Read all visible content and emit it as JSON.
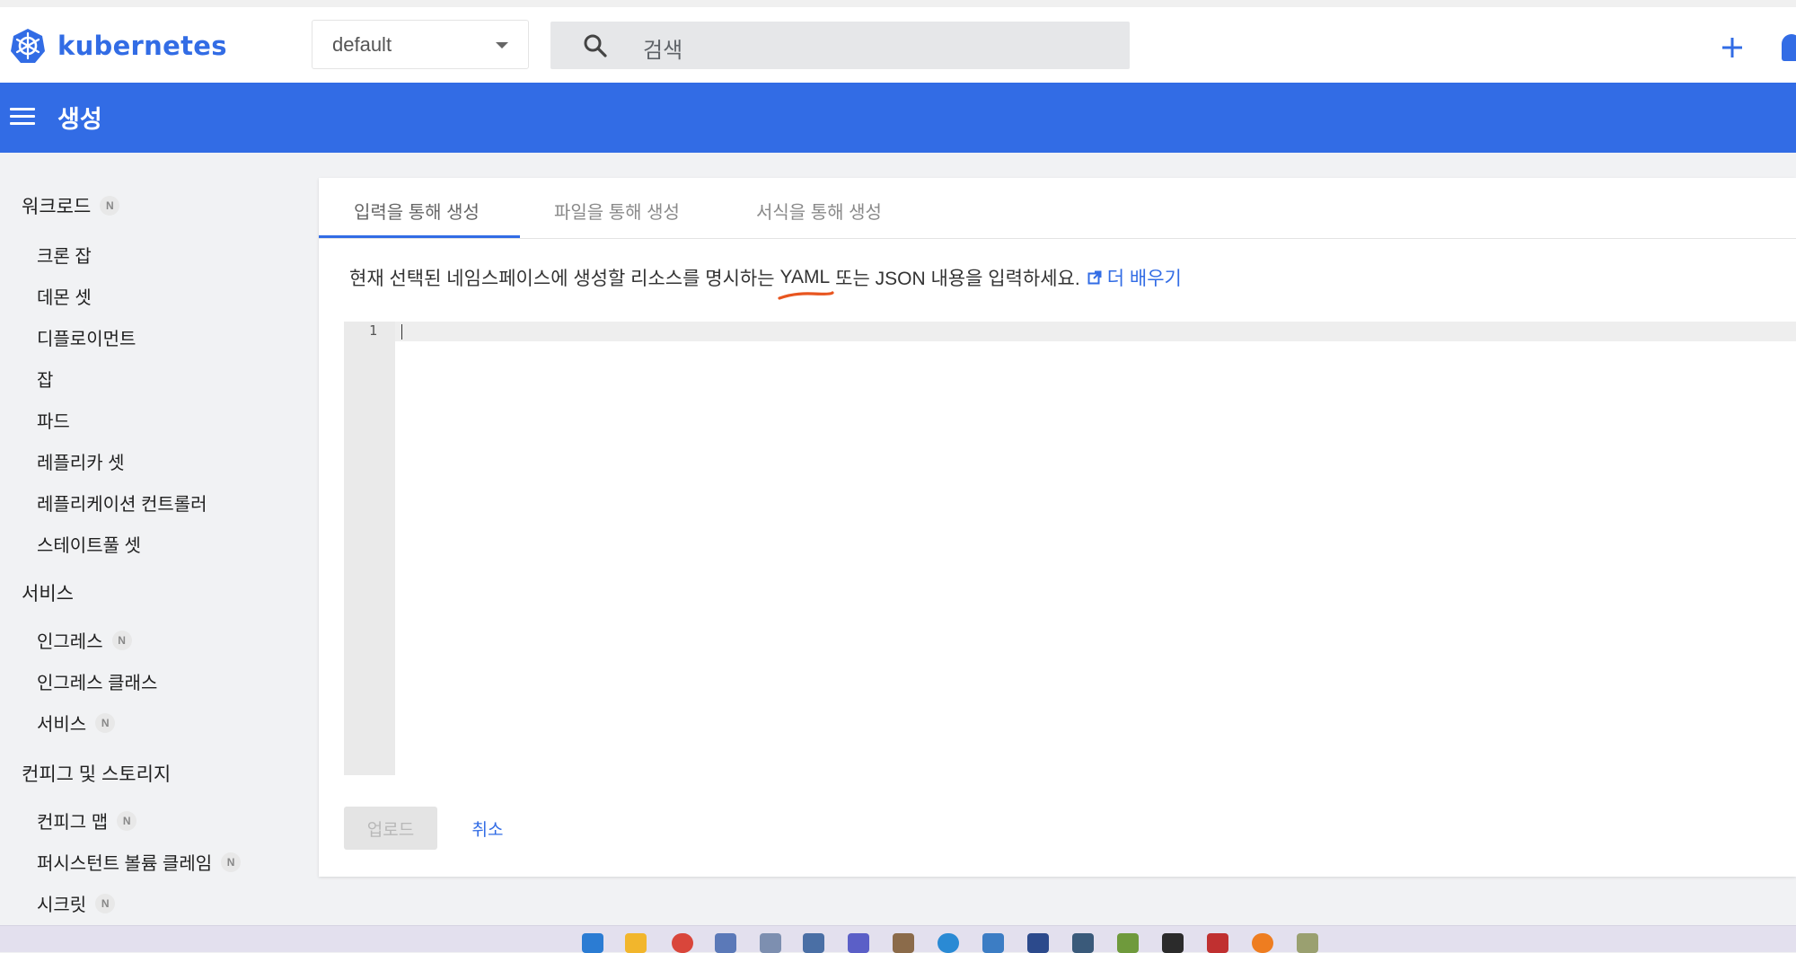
{
  "app": {
    "logo_text": "kubernetes"
  },
  "header": {
    "namespace": "default",
    "search_placeholder": "검색"
  },
  "toolbar": {
    "title": "생성"
  },
  "sidebar": {
    "sections": [
      {
        "label": "워크로드",
        "badge": "N"
      },
      {
        "label": "서비스",
        "badge": ""
      },
      {
        "label": "컨피그 및 스토리지",
        "badge": ""
      }
    ],
    "workloads": [
      {
        "label": "크론 잡",
        "badge": ""
      },
      {
        "label": "데몬 셋",
        "badge": ""
      },
      {
        "label": "디플로이먼트",
        "badge": ""
      },
      {
        "label": "잡",
        "badge": ""
      },
      {
        "label": "파드",
        "badge": ""
      },
      {
        "label": "레플리카 셋",
        "badge": ""
      },
      {
        "label": "레플리케이션 컨트롤러",
        "badge": ""
      },
      {
        "label": "스테이트풀 셋",
        "badge": ""
      }
    ],
    "services": [
      {
        "label": "인그레스",
        "badge": "N"
      },
      {
        "label": "인그레스 클래스",
        "badge": ""
      },
      {
        "label": "서비스",
        "badge": "N"
      }
    ],
    "config": [
      {
        "label": "컨피그 맵",
        "badge": "N"
      },
      {
        "label": "퍼시스턴트 볼륨 클레임",
        "badge": "N"
      },
      {
        "label": "시크릿",
        "badge": "N"
      }
    ]
  },
  "tabs": [
    {
      "label": "입력을 통해 생성",
      "active": true
    },
    {
      "label": "파일을 통해 생성",
      "active": false
    },
    {
      "label": "서식을 통해 생성",
      "active": false
    }
  ],
  "form": {
    "description_before": "현재 선택된 네임스페이스에 생성할 리소스를 명시하는",
    "description_yaml": "YAML",
    "description_after": "또는 JSON 내용을 입력하세요.",
    "learn_more": "더 배우기",
    "editor_line_number": "1",
    "upload_label": "업로드",
    "cancel_label": "취소"
  },
  "colors": {
    "accent": "#326ce5",
    "annotation": "#e8551f"
  }
}
